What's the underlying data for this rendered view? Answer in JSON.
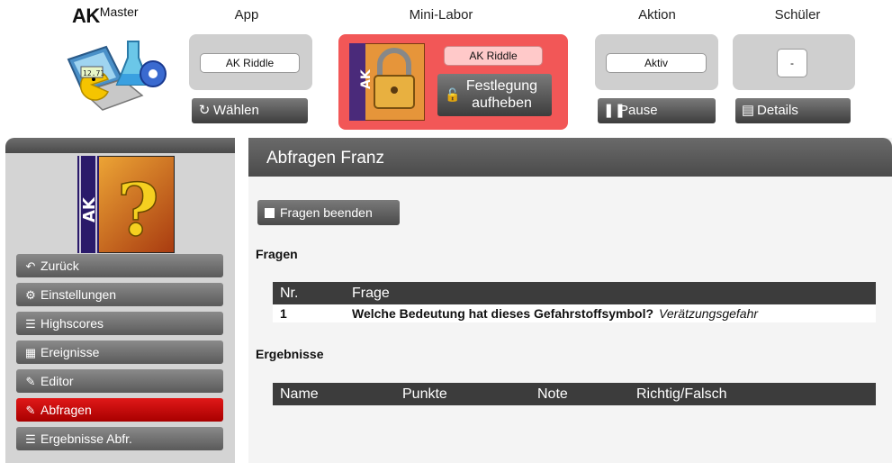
{
  "header": {
    "brand_bold": "AK",
    "brand_rest": "Master",
    "columns": {
      "app": "App",
      "mini_labor": "Mini-Labor",
      "aktion": "Aktion",
      "schueler": "Schüler"
    },
    "app_panel": {
      "value": "AK Riddle",
      "button": "Wählen"
    },
    "labor_panel": {
      "value": "AK Riddle",
      "button_line1": "Festlegung",
      "button_line2": "aufheben"
    },
    "aktion_panel": {
      "value": "Aktiv",
      "button": "Pause"
    },
    "schueler_panel": {
      "value": "-",
      "button": "Details"
    }
  },
  "sidebar": {
    "items": [
      {
        "label": "Zurück",
        "icon": "back-arrow-icon"
      },
      {
        "label": "Einstellungen",
        "icon": "gear-icon"
      },
      {
        "label": "Highscores",
        "icon": "list-icon"
      },
      {
        "label": "Ereignisse",
        "icon": "calendar-icon"
      },
      {
        "label": "Editor",
        "icon": "edit-icon"
      },
      {
        "label": "Abfragen",
        "icon": "edit-icon",
        "active": true
      },
      {
        "label": "Ergebnisse Abfr.",
        "icon": "list-icon"
      }
    ]
  },
  "main": {
    "title": "Abfragen Franz",
    "stop_button": "Fragen beenden",
    "questions_heading": "Fragen",
    "questions_table": {
      "headers": [
        "Nr.",
        "Frage"
      ],
      "rows": [
        {
          "nr": "1",
          "question": "Welche Bedeutung hat dieses Gefahrstoffsymbol?",
          "answer": "Verätzungsgefahr"
        }
      ]
    },
    "results_heading": "Ergebnisse",
    "results_table": {
      "headers": [
        "Name",
        "Punkte",
        "Note",
        "Richtig/Falsch"
      ]
    }
  },
  "colors": {
    "active_red": "#d00000",
    "labor_panel_red": "#f25757",
    "dark_bar": "#3c3c3c"
  }
}
